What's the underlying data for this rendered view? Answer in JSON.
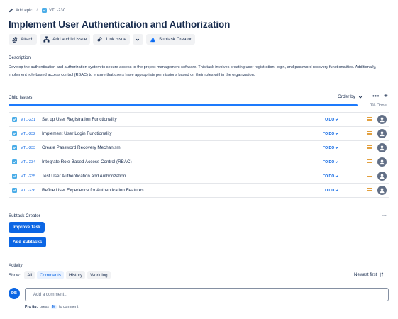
{
  "breadcrumb": {
    "add_epic": "Add epic",
    "separator": "/",
    "task_key": "VTL-230"
  },
  "issue": {
    "title": "Implement User Authentication and Authorization"
  },
  "toolbar": {
    "attach": "Attach",
    "add_child": "Add a child issue",
    "link_issue": "Link issue",
    "subtask_creator": "Subtask Creator"
  },
  "description": {
    "heading": "Description",
    "text": "Develop the authentication and authorization system to secure access to the project management software. This task involves creating user registration, login, and password recovery functionalities. Additionally, implement role-based access control (RBAC) to ensure that users have appropriate permissions based on their roles within the organization."
  },
  "child_issues": {
    "heading": "Child issues",
    "order_by": "Order by",
    "progress_percent": 0,
    "done_label": "0% Done",
    "items": [
      {
        "key": "VTL-231",
        "summary": "Set up User Registration Functionality",
        "status": "TO DO"
      },
      {
        "key": "VTL-232",
        "summary": "Implement User Login Functionality",
        "status": "TO DO"
      },
      {
        "key": "VTL-233",
        "summary": "Create Password Recovery Mechanism",
        "status": "TO DO"
      },
      {
        "key": "VTL-234",
        "summary": "Integrate Role-Based Access Control (RBAC)",
        "status": "TO DO"
      },
      {
        "key": "VTL-235",
        "summary": "Test User Authentication and Authorization",
        "status": "TO DO"
      },
      {
        "key": "VTL-236",
        "summary": "Refine User Experience for Authentication Features",
        "status": "TO DO"
      }
    ]
  },
  "subtask_creator": {
    "heading": "Subtask Creator",
    "more": "...",
    "improve_btn": "Improve Task",
    "add_btn": "Add Subtasks"
  },
  "activity": {
    "heading": "Activity",
    "show_label": "Show:",
    "filters": {
      "all": "All",
      "comments": "Comments",
      "history": "History",
      "worklog": "Work log"
    },
    "sort": "Newest first",
    "avatar_initials": "DB",
    "comment_placeholder": "Add a comment...",
    "protip_bold": "Pro tip:",
    "protip_pre": "press",
    "protip_key": "M",
    "protip_post": "to comment"
  },
  "colors": {
    "accent": "#0c66e4",
    "task_icon": "#4bade8",
    "priority_medium": "#e2a03f"
  }
}
